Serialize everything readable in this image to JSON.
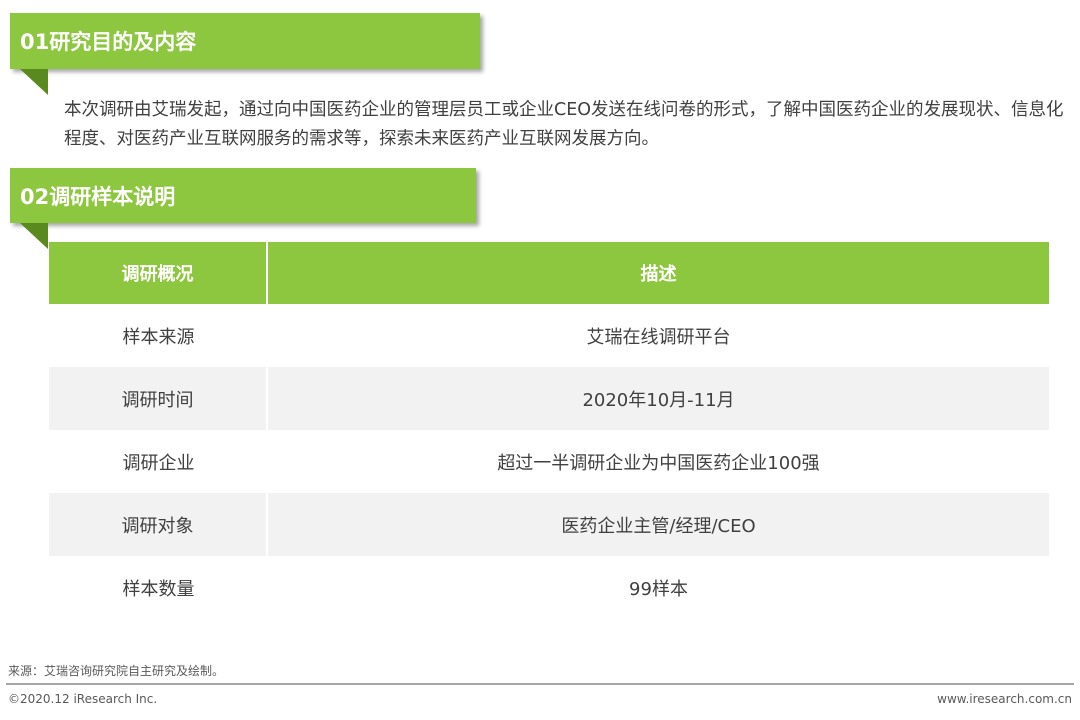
{
  "section1": {
    "title": "01研究目的及内容",
    "body": "本次调研由艾瑞发起，通过向中国医药企业的管理层员工或企业CEO发送在线问卷的形式，了解中国医药企业的发展现状、信息化程度、对医药产业互联网服务的需求等，探索未来医药产业互联网发展方向。"
  },
  "section2": {
    "title": "02调研样本说明"
  },
  "table": {
    "headers": [
      "调研概况",
      "描述"
    ],
    "rows": [
      [
        "样本来源",
        "艾瑞在线调研平台"
      ],
      [
        "调研时间",
        "2020年10月-11月"
      ],
      [
        "调研企业",
        "超过一半调研企业为中国医药企业100强"
      ],
      [
        "调研对象",
        "医药企业主管/经理/CEO"
      ],
      [
        "样本数量",
        "99样本"
      ]
    ]
  },
  "footer": {
    "source": "来源：艾瑞咨询研究院自主研究及绘制。",
    "copyright": "©2020.12 iResearch Inc.",
    "website": "www.iresearch.com.cn"
  },
  "colors": {
    "accent": "#8dc63f",
    "row_alt": "#f2f2f2"
  }
}
